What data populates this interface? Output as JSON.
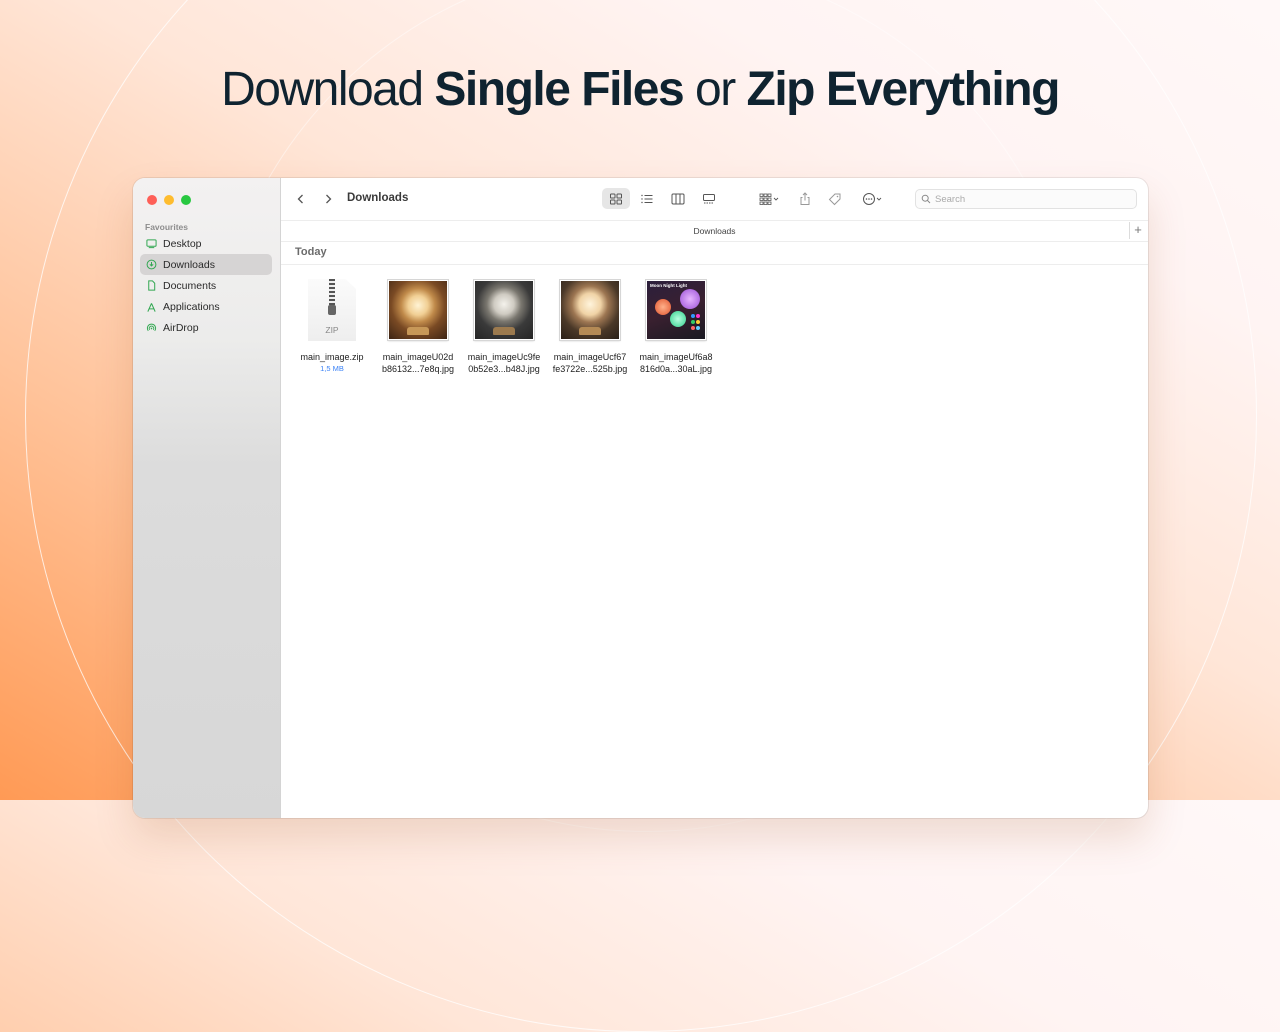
{
  "headline": {
    "part1": "Download ",
    "part2": "Single Files",
    "part3": " or ",
    "part4": "Zip Everything"
  },
  "finder": {
    "window_title": "Downloads",
    "sidebar": {
      "section_label": "Favourites",
      "items": [
        {
          "label": "Desktop",
          "icon": "desktop-icon"
        },
        {
          "label": "Downloads",
          "icon": "download-circle-icon",
          "selected": true
        },
        {
          "label": "Documents",
          "icon": "document-icon"
        },
        {
          "label": "Applications",
          "icon": "applications-icon"
        },
        {
          "label": "AirDrop",
          "icon": "airdrop-icon"
        }
      ]
    },
    "toolbar": {
      "icons": [
        "back-icon",
        "forward-icon",
        "icon-view-icon",
        "list-view-icon",
        "column-view-icon",
        "gallery-view-icon",
        "group-icon",
        "share-icon",
        "tag-icon",
        "more-icon"
      ],
      "active_view": "icon-view-icon"
    },
    "search": {
      "placeholder": "Search",
      "value": ""
    },
    "pathbar": {
      "label": "Downloads",
      "add_label": "+"
    },
    "group_header": "Today",
    "files": [
      {
        "name_line1": "main_image.zip",
        "name_line2": "",
        "size": "1,5 MB",
        "kind": "zip",
        "badge": "ZIP"
      },
      {
        "name_line1": "main_imageU02d",
        "name_line2": "b86132...7e8q.jpg",
        "kind": "jpg"
      },
      {
        "name_line1": "main_imageUc9fe",
        "name_line2": "0b52e3...b48J.jpg",
        "kind": "jpg"
      },
      {
        "name_line1": "main_imageUcf67",
        "name_line2": "fe3722e...525b.jpg",
        "kind": "jpg"
      },
      {
        "name_line1": "main_imageUf6a8",
        "name_line2": "816d0a...30aL.jpg",
        "kind": "jpg",
        "thumb_title": "Moon Night Light"
      }
    ]
  },
  "colors": {
    "accent_green": "#34a853",
    "size_blue": "#3b82f6",
    "traffic_red": "#fe5f57",
    "traffic_yellow": "#febc2e",
    "traffic_green": "#28c840",
    "headline": "#0f2330"
  }
}
